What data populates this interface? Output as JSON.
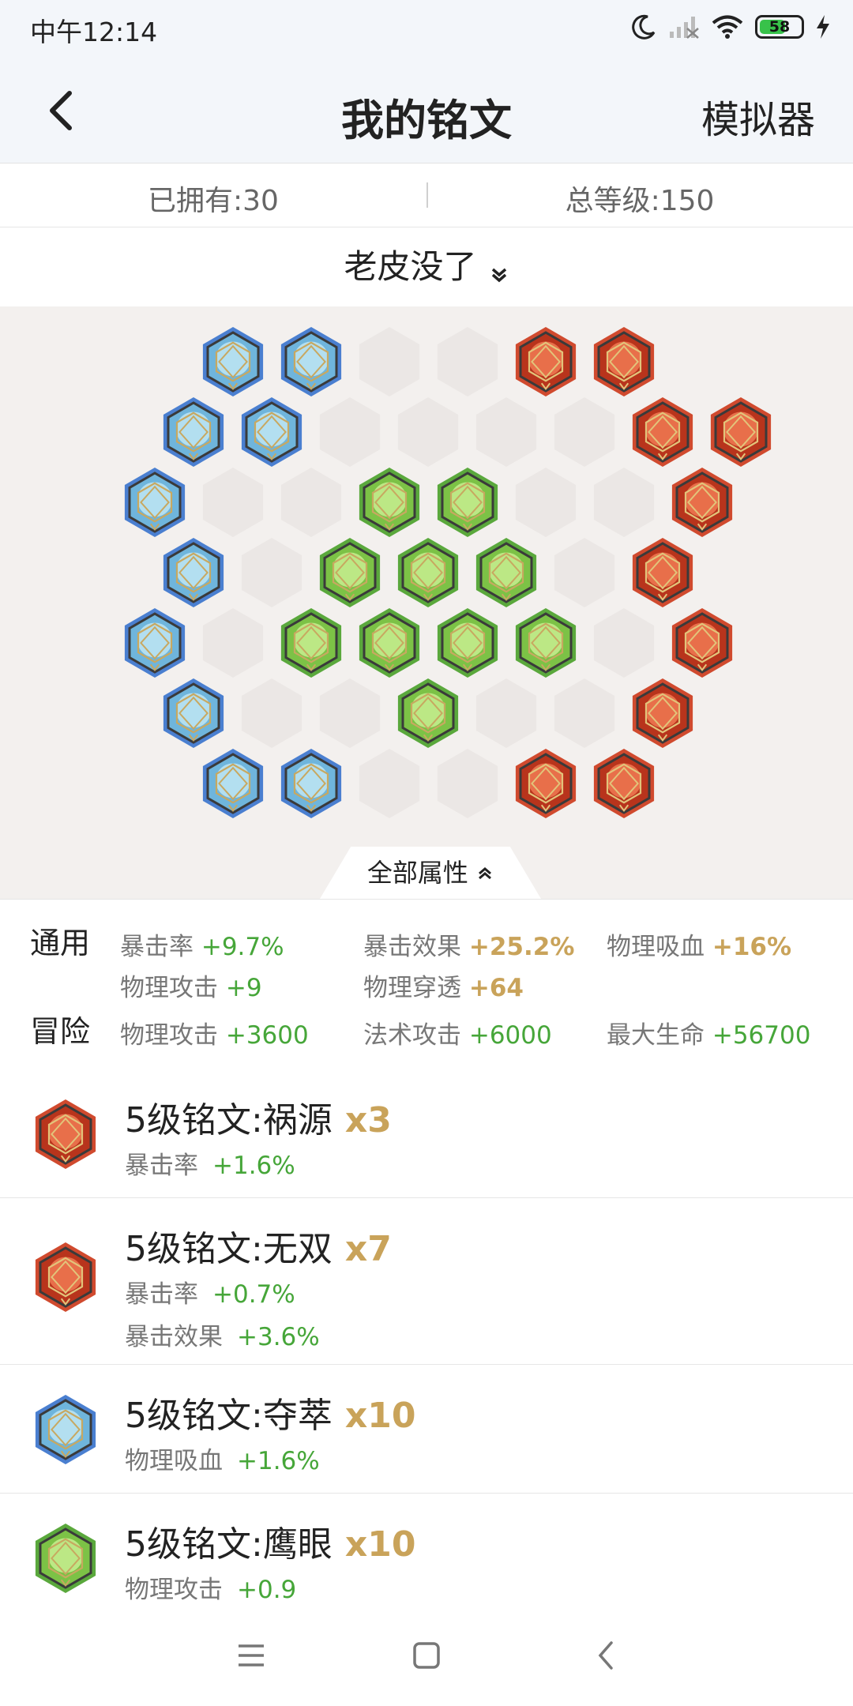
{
  "status": {
    "time": "中午12:14",
    "battery": "58"
  },
  "header": {
    "title": "我的铭文",
    "simulator": "模拟器"
  },
  "stats": {
    "owned": "已拥有:30",
    "level": "总等级:150"
  },
  "page": {
    "name": "老皮没了"
  },
  "attributes": {
    "toggle_label": "全部属性",
    "general": {
      "label": "通用",
      "items": [
        {
          "name": "暴击率",
          "value": "+9.7%"
        },
        {
          "name": "暴击效果",
          "value": "+25.2%"
        },
        {
          "name": "物理吸血",
          "value": "+16%"
        },
        {
          "name": "物理攻击",
          "value": "+9"
        },
        {
          "name": "物理穿透",
          "value": "+64"
        }
      ]
    },
    "adventure": {
      "label": "冒险",
      "items": [
        {
          "name": "物理攻击",
          "value": "+3600"
        },
        {
          "name": "法术攻击",
          "value": "+6000"
        },
        {
          "name": "最大生命",
          "value": "+56700"
        }
      ]
    }
  },
  "inscriptions": [
    {
      "name": "5级铭文:祸源",
      "count": "x3",
      "color": "red",
      "stats": [
        {
          "label": "暴击率",
          "value": "+1.6%"
        }
      ]
    },
    {
      "name": "5级铭文:无双",
      "count": "x7",
      "color": "red",
      "stats": [
        {
          "label": "暴击率",
          "value": "+0.7%"
        },
        {
          "label": "暴击效果",
          "value": "+3.6%"
        }
      ]
    },
    {
      "name": "5级铭文:夺萃",
      "count": "x10",
      "color": "blue",
      "stats": [
        {
          "label": "物理吸血",
          "value": "+1.6%"
        }
      ]
    },
    {
      "name": "5级铭文:鹰眼",
      "count": "x10",
      "color": "green",
      "stats": [
        {
          "label": "物理攻击",
          "value": "+0.9"
        }
      ]
    }
  ],
  "colors": {
    "blue": "#4a7fd0",
    "green": "#5aa83c",
    "red": "#d04a2e",
    "gold": "#c9a35a",
    "stat_green": "#46a639"
  },
  "icons": [
    "back-icon",
    "moon-icon",
    "signal-icon",
    "wifi-icon",
    "battery-icon",
    "charging-icon",
    "chevron-down-icon",
    "chevron-up-icon",
    "menu-icon",
    "home-icon",
    "nav-back-icon"
  ]
}
